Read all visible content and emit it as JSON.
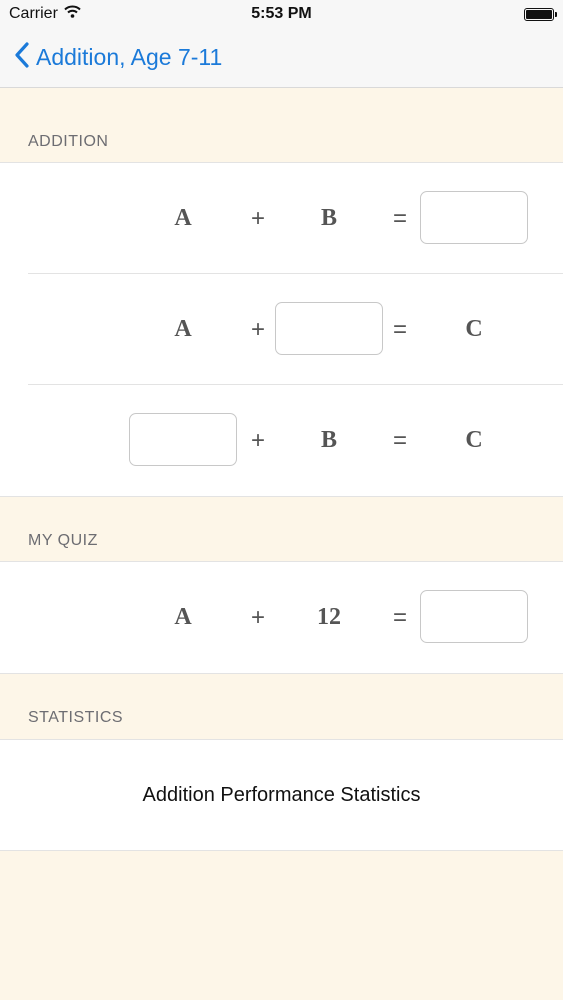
{
  "status_bar": {
    "carrier": "Carrier",
    "time": "5:53 PM"
  },
  "nav": {
    "back_label": "Addition, Age 7-11"
  },
  "sections": {
    "addition": {
      "header": "ADDITION",
      "rows": [
        {
          "a": "A",
          "op": "+",
          "b": "B",
          "eq": "=",
          "c": ""
        },
        {
          "a": "A",
          "op": "+",
          "b": "",
          "eq": "=",
          "c": "C"
        },
        {
          "a": "",
          "op": "+",
          "b": "B",
          "eq": "=",
          "c": "C"
        }
      ]
    },
    "my_quiz": {
      "header": "MY QUIZ",
      "row": {
        "a": "A",
        "op": "+",
        "b": "12",
        "eq": "=",
        "c": ""
      }
    },
    "statistics": {
      "header": "STATISTICS",
      "link_label": "Addition Performance Statistics"
    }
  },
  "colors": {
    "accent": "#1b7ad9",
    "background": "#fdf6e8"
  },
  "icons": {
    "back": "chevron-left-icon",
    "wifi": "wifi-icon",
    "battery": "battery-icon"
  }
}
